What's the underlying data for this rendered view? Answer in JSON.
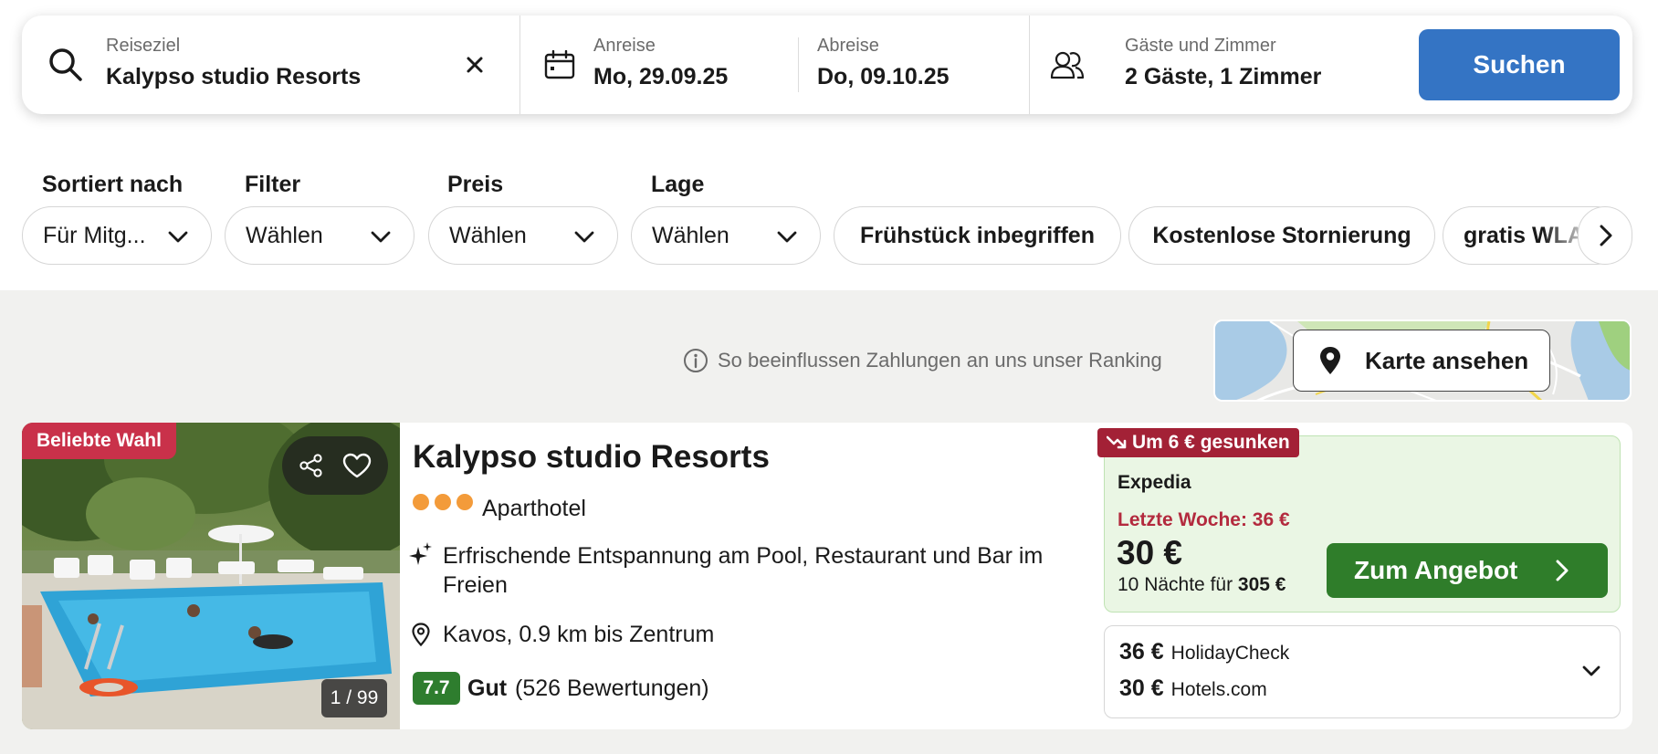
{
  "search": {
    "destination_label": "Reiseziel",
    "destination_value": "Kalypso studio Resorts",
    "checkin_label": "Anreise",
    "checkin_value": "Mo, 29.09.25",
    "checkout_label": "Abreise",
    "checkout_value": "Do, 09.10.25",
    "guests_label": "Gäste und Zimmer",
    "guests_value": "2 Gäste, 1 Zimmer",
    "search_button": "Suchen",
    "icons": [
      "search-icon",
      "clear-icon",
      "calendar-icon",
      "guests-icon"
    ]
  },
  "filters": {
    "sort": {
      "label": "Sortiert nach",
      "value": "Für Mitg..."
    },
    "filter": {
      "label": "Filter",
      "value": "Wählen"
    },
    "price": {
      "label": "Preis",
      "value": "Wählen"
    },
    "location": {
      "label": "Lage",
      "value": "Wählen"
    },
    "toggles": [
      "Frühstück inbegriffen",
      "Kostenlose Stornierung",
      "gratis WLAN"
    ]
  },
  "ranking_info": "So beeinflussen Zahlungen an uns unser Ranking",
  "map_button": "Karte ansehen",
  "hotel": {
    "badge": "Beliebte Wahl",
    "photo_counter": "1 / 99",
    "name": "Kalypso studio Resorts",
    "stars": 3,
    "type": "Aparthotel",
    "highlight": "Erfrischende Entspannung am Pool, Restaurant und Bar im Freien",
    "location": "Kavos, 0.9 km bis Zentrum",
    "score": "7.7",
    "rating_word": "Gut",
    "reviews": "(526 Bewertungen)",
    "offer": {
      "price_drop": "Um 6 € gesunken",
      "provider": "Expedia",
      "last_week": "Letzte Woche: 36 €",
      "price": "30 €",
      "nights_text": "10 Nächte für",
      "total": "305 €",
      "button": "Zum Angebot"
    },
    "other_offers": [
      {
        "price": "36 €",
        "provider": "HolidayCheck"
      },
      {
        "price": "30 €",
        "provider": "Hotels.com"
      }
    ]
  },
  "colors": {
    "search_button": "#3474c4",
    "deal_button": "#2f7d2a",
    "badge_red": "#c9314a",
    "price_drop_red": "#a32136",
    "score_green": "#2e7d2e",
    "star_orange": "#f39b3a"
  }
}
